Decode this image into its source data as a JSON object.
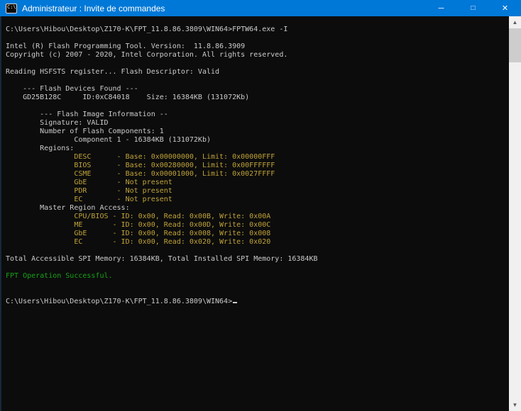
{
  "colors": {
    "titlebar_bg": "#0078d7",
    "console_bg": "#0c0c0c",
    "window_border": "#16293d",
    "text_default": "#cccccc",
    "text_yellow": "#c0a339",
    "text_green": "#18a218",
    "scroll_track": "#f0f0f0",
    "scroll_thumb": "#cdcdcd"
  },
  "window": {
    "title": "Administrateur : Invite de commandes",
    "icon_label": "C:\\",
    "controls": {
      "minimize": "─",
      "maximize": "□",
      "close": "✕"
    }
  },
  "scrollbar": {
    "up_glyph": "▲",
    "down_glyph": "▼"
  },
  "terminal": {
    "lines": [
      {
        "text": "C:\\Users\\Hibou\\Desktop\\Z170-K\\FPT_11.8.86.3809\\WIN64>FPTW64.exe -I",
        "color": "default"
      },
      {
        "text": "",
        "color": "default"
      },
      {
        "text": "Intel (R) Flash Programming Tool. Version:  11.8.86.3909",
        "color": "default"
      },
      {
        "text": "Copyright (c) 2007 - 2020, Intel Corporation. All rights reserved.",
        "color": "default"
      },
      {
        "text": "",
        "color": "default"
      },
      {
        "text": "Reading HSFSTS register... Flash Descriptor: Valid",
        "color": "default"
      },
      {
        "text": "",
        "color": "default"
      },
      {
        "text": "    --- Flash Devices Found ---",
        "color": "default"
      },
      {
        "text": "    GD25B128C     ID:0xC84018    Size: 16384KB (131072Kb)",
        "color": "default"
      },
      {
        "text": "",
        "color": "default"
      },
      {
        "text": "        --- Flash Image Information --",
        "color": "default"
      },
      {
        "text": "        Signature: VALID",
        "color": "default"
      },
      {
        "text": "        Number of Flash Components: 1",
        "color": "default"
      },
      {
        "text": "                Component 1 - 16384KB (131072Kb)",
        "color": "default"
      },
      {
        "text": "        Regions:",
        "color": "default"
      },
      {
        "text": "                DESC      - Base: 0x00000000, Limit: 0x00000FFF",
        "color": "yellow"
      },
      {
        "text": "                BIOS      - Base: 0x00280000, Limit: 0x00FFFFFF",
        "color": "yellow"
      },
      {
        "text": "                CSME      - Base: 0x00001000, Limit: 0x0027FFFF",
        "color": "yellow"
      },
      {
        "text": "                GbE       - Not present",
        "color": "yellow"
      },
      {
        "text": "                PDR       - Not present",
        "color": "yellow"
      },
      {
        "text": "                EC        - Not present",
        "color": "yellow"
      },
      {
        "text": "        Master Region Access:",
        "color": "default"
      },
      {
        "text": "                CPU/BIOS - ID: 0x00, Read: 0x00B, Write: 0x00A",
        "color": "yellow"
      },
      {
        "text": "                ME       - ID: 0x00, Read: 0x00D, Write: 0x00C",
        "color": "yellow"
      },
      {
        "text": "                GbE      - ID: 0x00, Read: 0x008, Write: 0x008",
        "color": "yellow"
      },
      {
        "text": "                EC       - ID: 0x00, Read: 0x020, Write: 0x020",
        "color": "yellow"
      },
      {
        "text": "",
        "color": "default"
      },
      {
        "text": "Total Accessible SPI Memory: 16384KB, Total Installed SPI Memory: 16384KB",
        "color": "default"
      },
      {
        "text": "",
        "color": "default"
      },
      {
        "text": "FPT Operation Successful.",
        "color": "green"
      },
      {
        "text": "",
        "color": "default"
      },
      {
        "text": "",
        "color": "default"
      },
      {
        "text": "C:\\Users\\Hibou\\Desktop\\Z170-K\\FPT_11.8.86.3809\\WIN64>",
        "color": "default",
        "cursor": true
      }
    ]
  }
}
